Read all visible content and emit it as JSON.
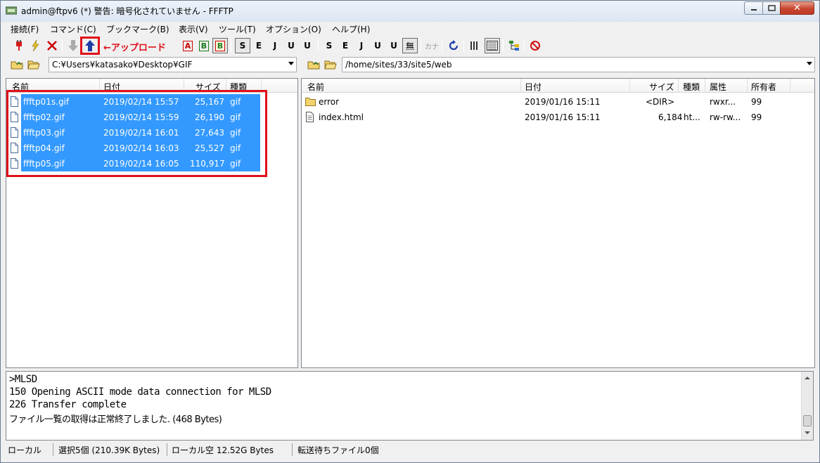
{
  "window": {
    "title": "admin@ftpv6 (*) 警告: 暗号化されていません - FFFTP"
  },
  "menu": [
    "接続(F)",
    "コマンド(C)",
    "ブックマーク(B)",
    "表示(V)",
    "ツール(T)",
    "オプション(O)",
    "ヘルプ(H)"
  ],
  "toolbar": {
    "annotation": "←アップロード",
    "labels": {
      "ascii": "A",
      "binary": "B",
      "auto": "B",
      "sjis_l": "S",
      "euc_l": "E",
      "jis_l": "J",
      "utf8_l": "U",
      "utf8bom_l": "U",
      "sjis_r": "S",
      "euc_r": "E",
      "jis_r": "J",
      "utf8_r": "U",
      "utf8bom_r": "U",
      "nochange": "無",
      "kana": "カナ"
    }
  },
  "local": {
    "path": "C:¥Users¥katasako¥Desktop¥GIF",
    "columns": [
      "名前",
      "日付",
      "サイズ",
      "種類"
    ],
    "files": [
      {
        "name": "ffftp01s.gif",
        "date": "2019/02/14 15:57",
        "size": "25,167",
        "type": "gif"
      },
      {
        "name": "ffftp02.gif",
        "date": "2019/02/14 15:59",
        "size": "26,190",
        "type": "gif"
      },
      {
        "name": "ffftp03.gif",
        "date": "2019/02/14 16:01",
        "size": "27,643",
        "type": "gif"
      },
      {
        "name": "ffftp04.gif",
        "date": "2019/02/14 16:03",
        "size": "25,527",
        "type": "gif"
      },
      {
        "name": "ffftp05.gif",
        "date": "2019/02/14 16:05",
        "size": "110,917",
        "type": "gif"
      }
    ]
  },
  "remote": {
    "path": "/home/sites/33/site5/web",
    "columns": [
      "名前",
      "日付",
      "サイズ",
      "種類",
      "属性",
      "所有者"
    ],
    "files": [
      {
        "name": "error",
        "date": "2019/01/16 15:11",
        "size": "<DIR>",
        "type": "",
        "attr": "rwxr...",
        "owner": "99",
        "icon": "folder-icon"
      },
      {
        "name": "index.html",
        "date": "2019/01/16 15:11",
        "size": "6,184",
        "type": "ht...",
        "attr": "rw-rw...",
        "owner": "99",
        "icon": "file-icon"
      }
    ]
  },
  "log": [
    ">MLSD",
    "150 Opening ASCII mode data connection for MLSD",
    "226 Transfer complete",
    "ファイル一覧の取得は正常終了しました. (468 Bytes)"
  ],
  "status": {
    "side": "ローカル",
    "selection": "選択5個 (210.39K Bytes)",
    "free": "ローカル空 12.52G Bytes",
    "queue": "転送待ちファイル0個"
  },
  "colors": {
    "selection": "#3399ff",
    "annotation": "#e0111b"
  }
}
